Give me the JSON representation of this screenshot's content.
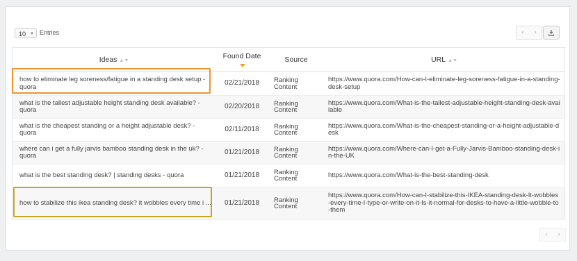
{
  "toolbar": {
    "page_size": "10",
    "entries_label": "Entries",
    "prev_icon": "chevron-left-icon",
    "next_icon": "chevron-right-icon",
    "download_icon": "download-icon"
  },
  "table": {
    "headers": {
      "ideas": "Ideas",
      "found_date": "Found Date",
      "source": "Source",
      "url": "URL"
    },
    "rows": [
      {
        "idea": "how to eliminate leg soreness/fatigue in a standing desk setup - quora",
        "date": "02/21/2018",
        "source": "Ranking Content",
        "url": "https://www.quora.com/How-can-I-eliminate-leg-soreness-fatigue-in-a-standing-desk-setup"
      },
      {
        "idea": "what is the tallest adjustable height standing desk available? - quora",
        "date": "02/20/2018",
        "source": "Ranking Content",
        "url": "https://www.quora.com/What-is-the-tallest-adjustable-height-standing-desk-available"
      },
      {
        "idea": "what is the cheapest standing or a height adjustable desk? - quora",
        "date": "02/11/2018",
        "source": "Ranking Content",
        "url": "https://www.quora.com/What-is-the-cheapest-standing-or-a-height-adjustable-desk"
      },
      {
        "idea": "where can i get a fully jarvis bamboo standing desk in the uk? - quora",
        "date": "01/21/2018",
        "source": "Ranking Content",
        "url": "https://www.quora.com/Where-can-I-get-a-Fully-Jarvis-Bamboo-standing-desk-in-the-UK"
      },
      {
        "idea": "what is the best standing desk? | standing desks - quora",
        "date": "01/21/2018",
        "source": "Ranking Content",
        "url": "https://www.quora.com/What-is-the-best-standing-desk"
      },
      {
        "idea": "how to stabilize this ikea standing desk? it wobbles every time i ...",
        "date": "01/21/2018",
        "source": "Ranking Content",
        "url": "https://www.quora.com/How-can-I-stabilize-this-IKEA-standing-desk-It-wobbles-every-time-I-type-or-write-on-it-Is-it-normal-for-desks-to-have-a-little-wobble-to-them"
      }
    ]
  },
  "colors": {
    "highlight_orange": "#f0922b",
    "highlight_yellow": "#c9a51e",
    "sort_active": "#f0a030"
  }
}
